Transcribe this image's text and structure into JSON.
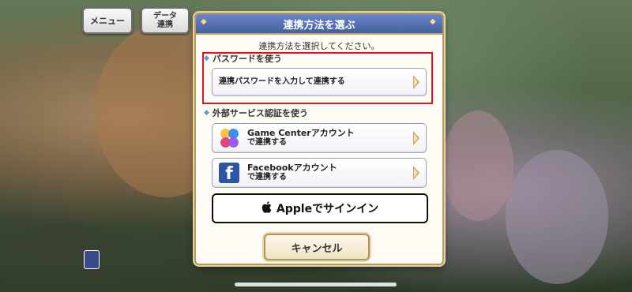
{
  "top_buttons": {
    "menu": "メニュー",
    "data": "データ\n連携"
  },
  "dialog": {
    "title": "連携方法を選ぶ",
    "subtitle": "連携方法を選択してください。",
    "password_section": {
      "label": "パスワードを使う",
      "button": "連携パスワードを入力して連携する"
    },
    "external_section": {
      "label": "外部サービス認証を使う",
      "game_center": {
        "line1": "Game Centerアカウント",
        "line2": "で連携する"
      },
      "facebook": {
        "line1": "Facebookアカウント",
        "line2": "で連携する"
      },
      "apple": "Appleでサインイン"
    },
    "cancel": "キャンセル"
  },
  "colors": {
    "highlight": "#e0141e",
    "header_blue": "#4f6cb0",
    "facebook": "#2d55a7",
    "gold_border": "#b69a5b"
  },
  "icons": {
    "game_center": "game-center-icon",
    "facebook": "facebook-icon",
    "apple": "apple-icon"
  }
}
